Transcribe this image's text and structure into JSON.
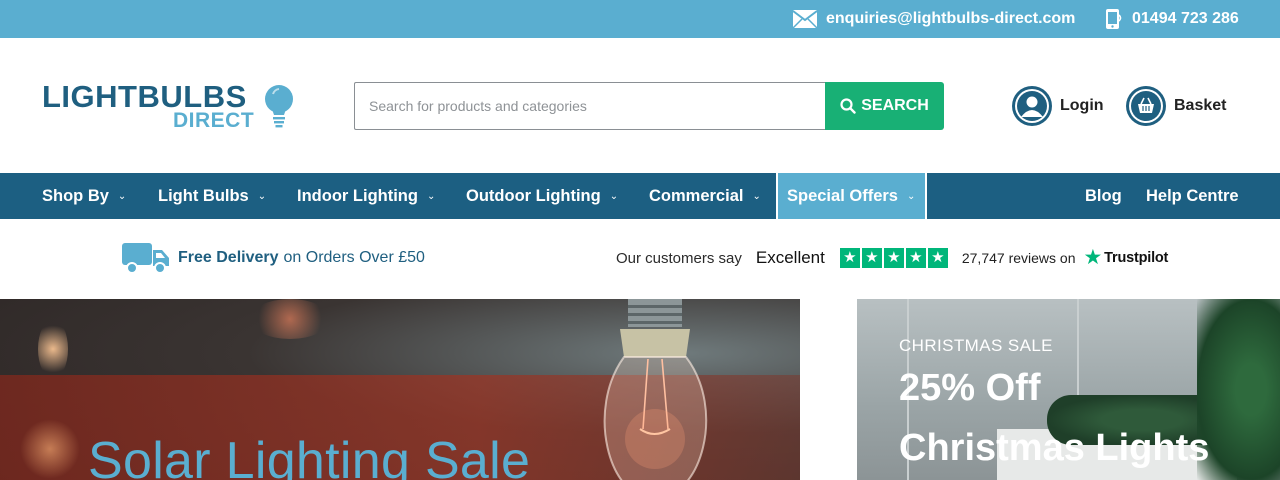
{
  "topbar": {
    "email": "enquiries@lightbulbs-direct.com",
    "phone": "01494 723 286"
  },
  "brand": {
    "line1": "LIGHTBULBS",
    "line2": "DIRECT"
  },
  "search": {
    "placeholder": "Search for products and categories",
    "button_label": "SEARCH"
  },
  "account": {
    "login_label": "Login",
    "basket_label": "Basket"
  },
  "nav": {
    "items": [
      {
        "label": "Shop By"
      },
      {
        "label": "Light Bulbs"
      },
      {
        "label": "Indoor Lighting"
      },
      {
        "label": "Outdoor Lighting"
      },
      {
        "label": "Commercial"
      },
      {
        "label": "Special Offers"
      }
    ],
    "right": [
      {
        "label": "Blog"
      },
      {
        "label": "Help Centre"
      }
    ]
  },
  "usp": {
    "delivery_bold": "Free Delivery",
    "delivery_rest": "on Orders Over £50"
  },
  "trustpilot": {
    "customers_say": "Our customers say",
    "rating_word": "Excellent",
    "stars": 5,
    "reviews": "27,747 reviews on",
    "brand": "Trustpilot"
  },
  "hero_left": {
    "title": "Solar Lighting Sale"
  },
  "hero_right": {
    "kicker": "CHRISTMAS SALE",
    "line1": "25% Off",
    "line2": "Christmas Lights"
  },
  "colors": {
    "topbar": "#5aaed0",
    "nav": "#1c5f82",
    "accent_green": "#18b075",
    "trustpilot_green": "#00b67a"
  }
}
